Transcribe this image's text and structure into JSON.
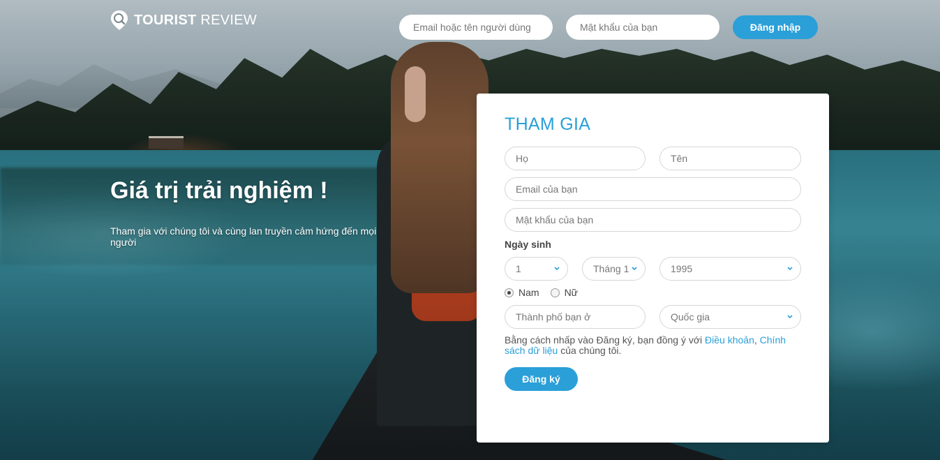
{
  "brand": {
    "bold": "TOURIST",
    "light": "REVIEW"
  },
  "header": {
    "email_placeholder": "Email hoặc tên người dùng",
    "password_placeholder": "Mật khẩu của bạn",
    "login_label": "Đăng nhập"
  },
  "hero": {
    "title": "Giá trị trải nghiệm !",
    "subtitle": "Tham gia với chúng tôi và cùng lan truyền cảm hứng đến mọi người"
  },
  "signup": {
    "title": "THAM GIA",
    "last_name_placeholder": "Họ",
    "first_name_placeholder": "Tên",
    "email_placeholder": "Email của bạn",
    "password_placeholder": "Mật khẩu của bạn",
    "dob_label": "Ngày sinh",
    "day": "1",
    "month": "Tháng 1",
    "year": "1995",
    "gender_male": "Nam",
    "gender_female": "Nữ",
    "gender_selected": "Nam",
    "city_placeholder": "Thành phố bạn ở",
    "country": "Quốc gia",
    "terms_prefix": "Bằng cách nhấp vào Đăng ký, bạn đồng ý với ",
    "terms_link": "Điều khoản",
    "terms_sep": ", ",
    "privacy_link": "Chính sách dữ liệu",
    "terms_suffix": " của chúng tôi.",
    "submit_label": "Đăng ký"
  },
  "colors": {
    "accent": "#2a9fd8",
    "card_bg": "#ffffff",
    "text_dark": "#444444"
  },
  "icons": {
    "logo": "map-pin-search-icon",
    "select_chevron": "chevron-down-icon"
  }
}
